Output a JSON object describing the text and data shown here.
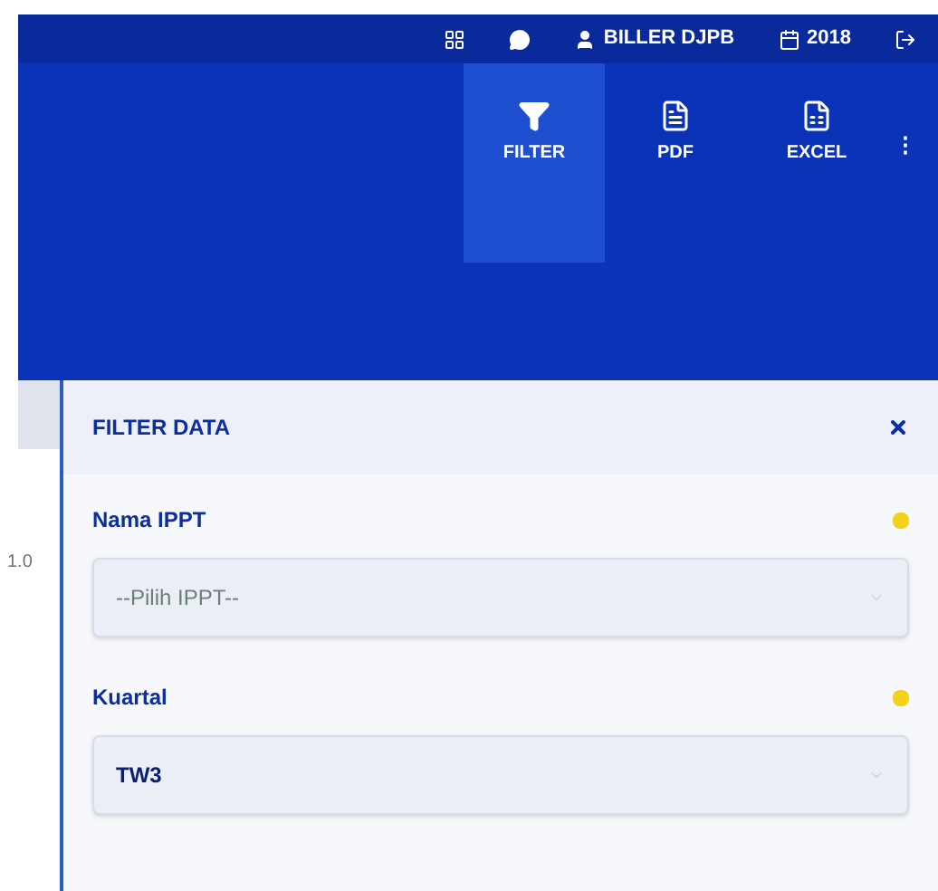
{
  "topbar": {
    "user": "BILLER DJPB",
    "year": "2018"
  },
  "toolbar": [
    {
      "kind": "filter",
      "label": "FILTER",
      "selected": true
    },
    {
      "kind": "pdf",
      "label": "PDF",
      "selected": false
    },
    {
      "kind": "excel",
      "label": "EXCEL",
      "selected": false
    }
  ],
  "more_button": "⋮",
  "background_chart": {
    "axis_label": "1.0"
  },
  "filter_panel": {
    "title": "FILTER DATA",
    "fields": [
      {
        "label": "Nama IPPT",
        "placeholder": "--Pilih IPPT--"
      },
      {
        "label": "Kuartal",
        "value": "TW3"
      }
    ]
  }
}
